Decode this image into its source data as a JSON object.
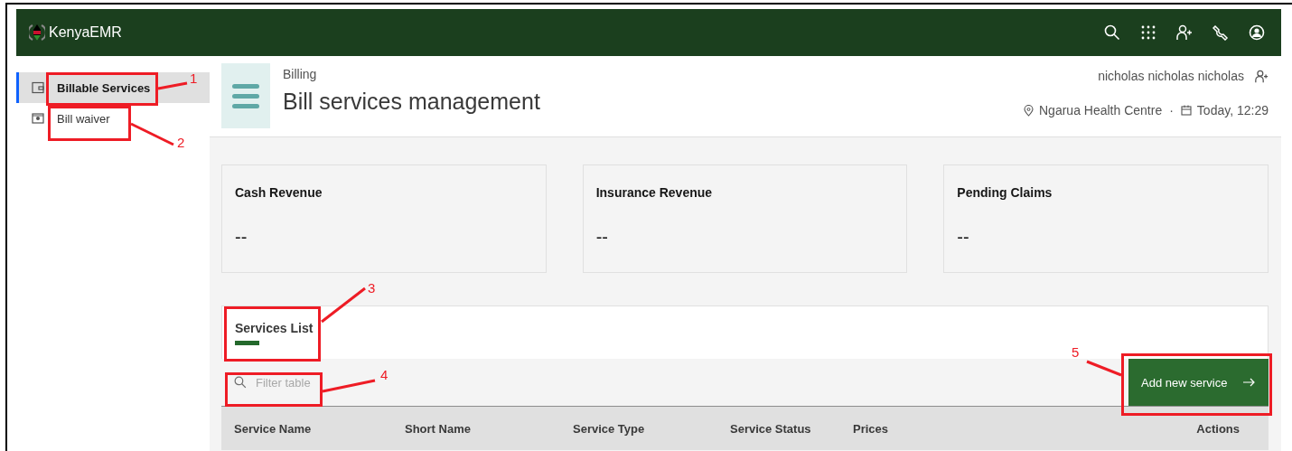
{
  "header": {
    "brand": "KenyaEMR"
  },
  "sidebar": {
    "items": [
      {
        "label": "Billable Services",
        "selected": true
      },
      {
        "label": "Bill waiver",
        "selected": false
      }
    ]
  },
  "page_header": {
    "breadcrumb": "Billing",
    "title": "Bill services management",
    "user": "nicholas nicholas nicholas",
    "location": "Ngarua Health Centre",
    "separator": "·",
    "date": "Today, 12:29"
  },
  "metrics": [
    {
      "label": "Cash Revenue",
      "value": "--"
    },
    {
      "label": "Insurance Revenue",
      "value": "--"
    },
    {
      "label": "Pending Claims",
      "value": "--"
    }
  ],
  "services": {
    "tabs": [
      {
        "label": "Services List",
        "selected": true
      }
    ],
    "filter_placeholder": "Filter table",
    "add_button": "Add new service",
    "columns": [
      "Service Name",
      "Short Name",
      "Service Type",
      "Service Status",
      "Prices",
      "Actions"
    ]
  },
  "annotations": [
    {
      "number": "1"
    },
    {
      "number": "2"
    },
    {
      "number": "3"
    },
    {
      "number": "4"
    },
    {
      "number": "5"
    }
  ]
}
